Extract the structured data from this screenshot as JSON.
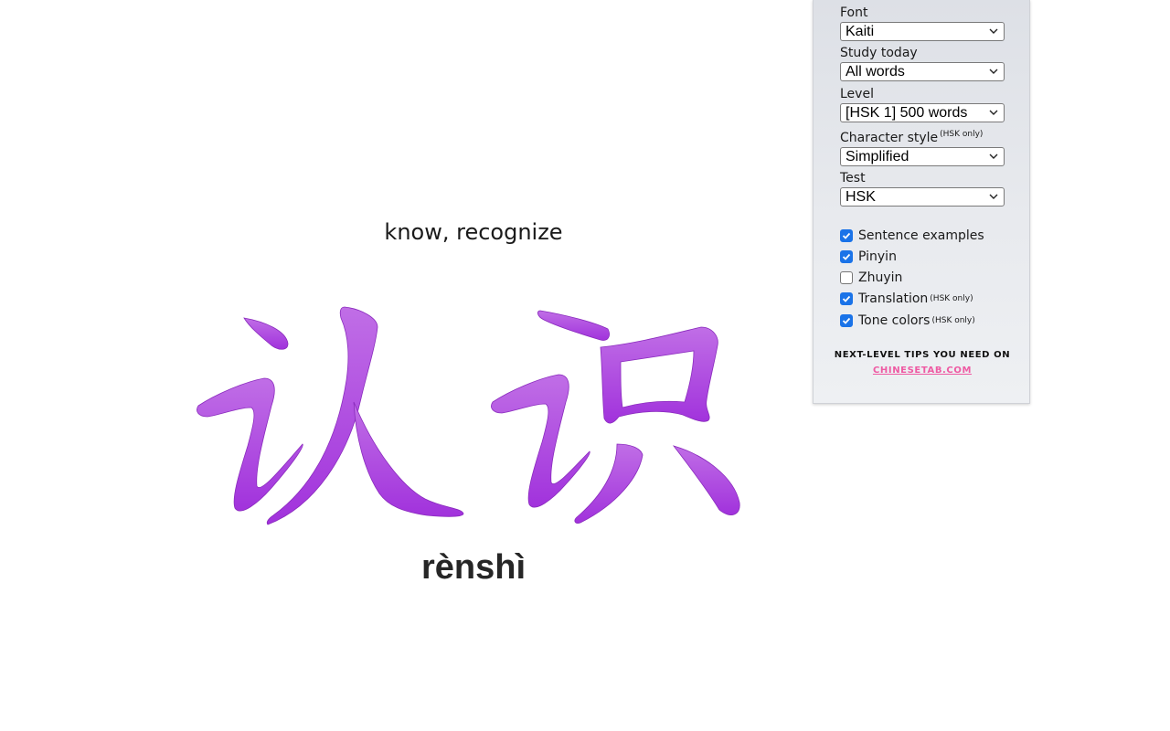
{
  "card": {
    "translation": "know, recognize",
    "characters": "认识",
    "pinyin": "rènshì",
    "character_color": "#b04fe0"
  },
  "settings": {
    "font": {
      "label": "Font",
      "value": "Kaiti"
    },
    "study_today": {
      "label": "Study today",
      "value": "All words"
    },
    "level": {
      "label": "Level",
      "value": "[HSK 1] 500 words"
    },
    "character_style": {
      "label": "Character style",
      "note": "(HSK only)",
      "value": "Simplified"
    },
    "test": {
      "label": "Test",
      "value": "HSK"
    },
    "options": [
      {
        "label": "Sentence examples",
        "note": "",
        "checked": true
      },
      {
        "label": "Pinyin",
        "note": "",
        "checked": true
      },
      {
        "label": "Zhuyin",
        "note": "",
        "checked": false
      },
      {
        "label": "Translation",
        "note": "(HSK only)",
        "checked": true
      },
      {
        "label": "Tone colors",
        "note": "(HSK only)",
        "checked": true
      }
    ],
    "tips": "NEXT-LEVEL TIPS YOU NEED ON",
    "link": "CHINESETAB.COM"
  },
  "colors": {
    "checkbox_accent": "#1a73e8",
    "link": "#ee5aa3"
  }
}
